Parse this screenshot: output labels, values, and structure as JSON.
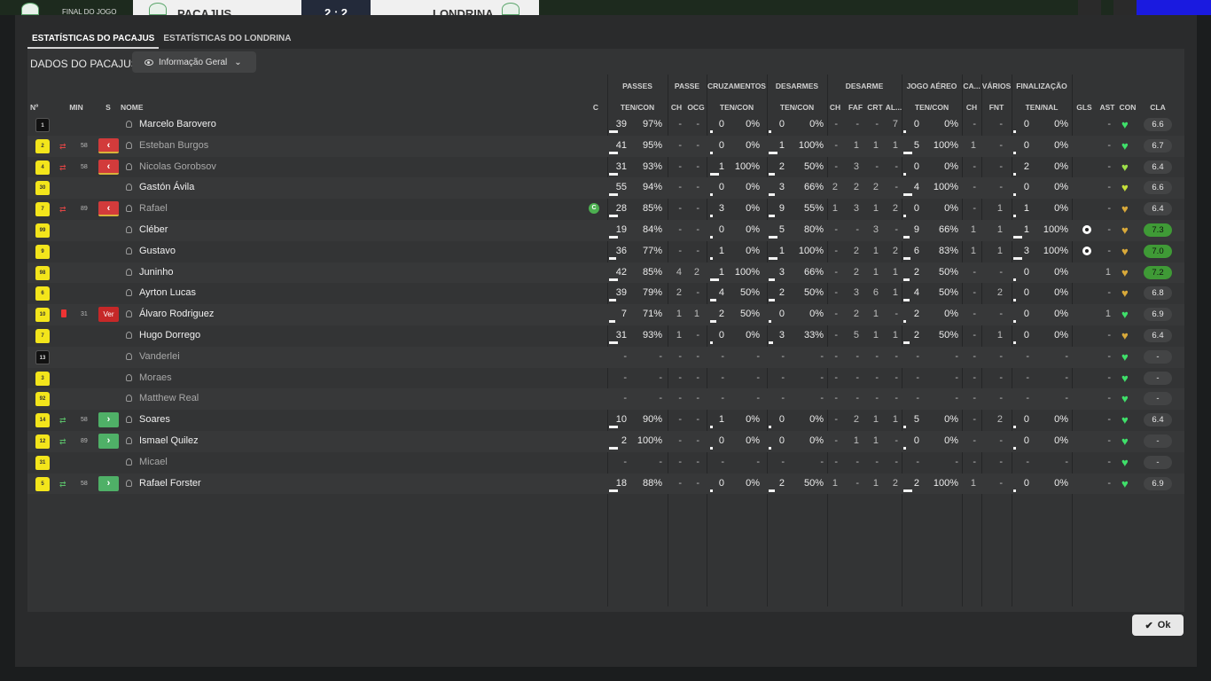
{
  "scoreboard": {
    "status": "FINAL DO JOGO",
    "home": "PACAJUS",
    "score": "2 : 2",
    "away": "LONDRINA"
  },
  "tabs": [
    {
      "label": "ESTATÍSTICAS DO PACAJUS",
      "active": true
    },
    {
      "label": "ESTATÍSTICAS DO LONDRINA",
      "active": false
    }
  ],
  "panel": {
    "title": "DADOS DO PACAJUS",
    "view_button": "Informação Geral"
  },
  "headers": {
    "groups": [
      "PASSES",
      "PASSE",
      "CRUZAMENTOS",
      "DESARMES",
      "DESARME",
      "JOGO AÉREO",
      "CA...",
      "VÁRIOS",
      "FINALIZAÇÃO"
    ],
    "columns": {
      "no": "Nº",
      "min": "MIN",
      "s": "S",
      "nome": "NOME",
      "c": "C",
      "passes": "TEN/CON",
      "ch1": "CH",
      "ocg": "OCG",
      "cruz": "TEN/CON",
      "desarmes": "TEN/CON",
      "ch2": "CH",
      "faf": "FAF",
      "crt": "CRT",
      "al": "AL...",
      "aereo": "TEN/CON",
      "ch3": "CH",
      "fnt": "FNT",
      "final": "TEN/NAL",
      "gls": "GLS",
      "ast": "AST",
      "con": "CON",
      "cla": "CLA"
    }
  },
  "players": [
    {
      "no": "1",
      "shirt": "b",
      "sub": "",
      "min": "",
      "btn": "",
      "name": "Marcelo Barovero",
      "dim": false,
      "captain": false,
      "passes": [
        "39",
        "97%"
      ],
      "passes_fill": 0.4,
      "ch1": "-",
      "ocg": "-",
      "cruz": [
        "0",
        "0%"
      ],
      "cruz_fill": 0,
      "des": [
        "0",
        "0%"
      ],
      "des_fill": 0,
      "dch": "-",
      "faf": "-",
      "crt": "-",
      "al": "7",
      "aer": [
        "0",
        "0%"
      ],
      "aer_fill": 0,
      "ach": "-",
      "fnt": "-",
      "fin": [
        "0",
        "0%"
      ],
      "fin_fill": 0,
      "gls": false,
      "ast": "-",
      "con": "#3fe06a",
      "cla": "6.6",
      "cla_hi": false
    },
    {
      "no": "2",
      "shirt": "y",
      "sub": "out",
      "min": "58",
      "btn": "out",
      "name": "Esteban Burgos",
      "dim": true,
      "captain": false,
      "passes": [
        "41",
        "95%"
      ],
      "passes_fill": 0.4,
      "ch1": "-",
      "ocg": "-",
      "cruz": [
        "0",
        "0%"
      ],
      "cruz_fill": 0,
      "des": [
        "1",
        "100%"
      ],
      "des_fill": 0.4,
      "dch": "-",
      "faf": "1",
      "crt": "1",
      "al": "1",
      "aer": [
        "5",
        "100%"
      ],
      "aer_fill": 0.4,
      "ach": "1",
      "fnt": "-",
      "fin": [
        "0",
        "0%"
      ],
      "fin_fill": 0,
      "gls": false,
      "ast": "-",
      "con": "#3fe06a",
      "cla": "6.7",
      "cla_hi": false
    },
    {
      "no": "4",
      "shirt": "y",
      "sub": "out",
      "min": "58",
      "btn": "out",
      "name": "Nicolas Gorobsov",
      "dim": true,
      "captain": false,
      "passes": [
        "31",
        "93%"
      ],
      "passes_fill": 0.4,
      "ch1": "-",
      "ocg": "-",
      "cruz": [
        "1",
        "100%"
      ],
      "cruz_fill": 0.4,
      "des": [
        "2",
        "50%"
      ],
      "des_fill": 0.3,
      "dch": "-",
      "faf": "3",
      "crt": "-",
      "al": "-",
      "aer": [
        "0",
        "0%"
      ],
      "aer_fill": 0,
      "ach": "-",
      "fnt": "-",
      "fin": [
        "2",
        "0%"
      ],
      "fin_fill": 0,
      "gls": false,
      "ast": "-",
      "con": "#9ee04a",
      "cla": "6.4",
      "cla_hi": false
    },
    {
      "no": "30",
      "shirt": "y",
      "sub": "",
      "min": "",
      "btn": "",
      "name": "Gastón Ávila",
      "dim": false,
      "captain": false,
      "passes": [
        "55",
        "94%"
      ],
      "passes_fill": 0.4,
      "ch1": "-",
      "ocg": "-",
      "cruz": [
        "0",
        "0%"
      ],
      "cruz_fill": 0,
      "des": [
        "3",
        "66%"
      ],
      "des_fill": 0.3,
      "dch": "2",
      "faf": "2",
      "crt": "2",
      "al": "-",
      "aer": [
        "4",
        "100%"
      ],
      "aer_fill": 0.4,
      "ach": "-",
      "fnt": "-",
      "fin": [
        "0",
        "0%"
      ],
      "fin_fill": 0,
      "gls": false,
      "ast": "-",
      "con": "#c6e03a",
      "cla": "6.6",
      "cla_hi": false
    },
    {
      "no": "7",
      "shirt": "y",
      "sub": "out",
      "min": "89",
      "btn": "out",
      "name": "Rafael",
      "dim": true,
      "captain": true,
      "passes": [
        "28",
        "85%"
      ],
      "passes_fill": 0.4,
      "ch1": "-",
      "ocg": "-",
      "cruz": [
        "3",
        "0%"
      ],
      "cruz_fill": 0,
      "des": [
        "9",
        "55%"
      ],
      "des_fill": 0.3,
      "dch": "1",
      "faf": "3",
      "crt": "1",
      "al": "2",
      "aer": [
        "0",
        "0%"
      ],
      "aer_fill": 0,
      "ach": "-",
      "fnt": "1",
      "fin": [
        "1",
        "0%"
      ],
      "fin_fill": 0,
      "gls": false,
      "ast": "-",
      "con": "#d9a93a",
      "cla": "6.4",
      "cla_hi": false
    },
    {
      "no": "99",
      "shirt": "y",
      "sub": "",
      "min": "",
      "btn": "",
      "name": "Cléber",
      "dim": false,
      "captain": false,
      "passes": [
        "19",
        "84%"
      ],
      "passes_fill": 0.4,
      "ch1": "-",
      "ocg": "-",
      "cruz": [
        "0",
        "0%"
      ],
      "cruz_fill": 0,
      "des": [
        "5",
        "80%"
      ],
      "des_fill": 0.4,
      "dch": "-",
      "faf": "-",
      "crt": "3",
      "al": "-",
      "aer": [
        "9",
        "66%"
      ],
      "aer_fill": 0.3,
      "ach": "1",
      "fnt": "1",
      "fin": [
        "1",
        "100%"
      ],
      "fin_fill": 0.4,
      "gls": true,
      "ast": "-",
      "con": "#d9a93a",
      "cla": "7.3",
      "cla_hi": true
    },
    {
      "no": "9",
      "shirt": "y",
      "sub": "",
      "min": "",
      "btn": "",
      "name": "Gustavo",
      "dim": false,
      "captain": false,
      "passes": [
        "36",
        "77%"
      ],
      "passes_fill": 0.35,
      "ch1": "-",
      "ocg": "-",
      "cruz": [
        "1",
        "0%"
      ],
      "cruz_fill": 0,
      "des": [
        "1",
        "100%"
      ],
      "des_fill": 0.4,
      "dch": "-",
      "faf": "2",
      "crt": "1",
      "al": "2",
      "aer": [
        "6",
        "83%"
      ],
      "aer_fill": 0.35,
      "ach": "1",
      "fnt": "1",
      "fin": [
        "3",
        "100%"
      ],
      "fin_fill": 0.4,
      "gls": true,
      "ast": "-",
      "con": "#d9a93a",
      "cla": "7.0",
      "cla_hi": true
    },
    {
      "no": "98",
      "shirt": "y",
      "sub": "",
      "min": "",
      "btn": "",
      "name": "Juninho",
      "dim": false,
      "captain": false,
      "passes": [
        "42",
        "85%"
      ],
      "passes_fill": 0.4,
      "ch1": "4",
      "ocg": "2",
      "cruz": [
        "1",
        "100%"
      ],
      "cruz_fill": 0.4,
      "des": [
        "3",
        "66%"
      ],
      "des_fill": 0.3,
      "dch": "-",
      "faf": "2",
      "crt": "1",
      "al": "1",
      "aer": [
        "2",
        "50%"
      ],
      "aer_fill": 0.3,
      "ach": "-",
      "fnt": "-",
      "fin": [
        "0",
        "0%"
      ],
      "fin_fill": 0,
      "gls": false,
      "ast": "1",
      "con": "#d9a93a",
      "cla": "7.2",
      "cla_hi": true
    },
    {
      "no": "6",
      "shirt": "y",
      "sub": "",
      "min": "",
      "btn": "",
      "name": "Ayrton Lucas",
      "dim": false,
      "captain": false,
      "passes": [
        "39",
        "79%"
      ],
      "passes_fill": 0.35,
      "ch1": "2",
      "ocg": "-",
      "cruz": [
        "4",
        "50%"
      ],
      "cruz_fill": 0.3,
      "des": [
        "2",
        "50%"
      ],
      "des_fill": 0.3,
      "dch": "-",
      "faf": "3",
      "crt": "6",
      "al": "1",
      "aer": [
        "4",
        "50%"
      ],
      "aer_fill": 0.3,
      "ach": "-",
      "fnt": "2",
      "fin": [
        "0",
        "0%"
      ],
      "fin_fill": 0,
      "gls": false,
      "ast": "-",
      "con": "#d9a93a",
      "cla": "6.8",
      "cla_hi": false
    },
    {
      "no": "10",
      "shirt": "y",
      "sub": "red",
      "min": "31",
      "btn": "ver",
      "name": "Álvaro Rodriguez",
      "dim": false,
      "captain": false,
      "passes": [
        "7",
        "71%"
      ],
      "passes_fill": 0.3,
      "ch1": "1",
      "ocg": "1",
      "cruz": [
        "2",
        "50%"
      ],
      "cruz_fill": 0.3,
      "des": [
        "0",
        "0%"
      ],
      "des_fill": 0,
      "dch": "-",
      "faf": "2",
      "crt": "1",
      "al": "-",
      "aer": [
        "2",
        "0%"
      ],
      "aer_fill": 0,
      "ach": "-",
      "fnt": "-",
      "fin": [
        "0",
        "0%"
      ],
      "fin_fill": 0,
      "gls": false,
      "ast": "1",
      "con": "#3fe06a",
      "cla": "6.9",
      "cla_hi": false
    },
    {
      "no": "7",
      "shirt": "y",
      "sub": "",
      "min": "",
      "btn": "",
      "name": "Hugo Dorrego",
      "dim": false,
      "captain": false,
      "passes": [
        "31",
        "93%"
      ],
      "passes_fill": 0.4,
      "ch1": "1",
      "ocg": "-",
      "cruz": [
        "0",
        "0%"
      ],
      "cruz_fill": 0,
      "des": [
        "3",
        "33%"
      ],
      "des_fill": 0.2,
      "dch": "-",
      "faf": "5",
      "crt": "1",
      "al": "1",
      "aer": [
        "2",
        "50%"
      ],
      "aer_fill": 0.3,
      "ach": "-",
      "fnt": "1",
      "fin": [
        "0",
        "0%"
      ],
      "fin_fill": 0,
      "gls": false,
      "ast": "-",
      "con": "#d9a93a",
      "cla": "6.4",
      "cla_hi": false
    },
    {
      "no": "13",
      "shirt": "b",
      "sub": "",
      "min": "",
      "btn": "",
      "name": "Vanderlei",
      "dim": true,
      "captain": false,
      "passes": [
        "-",
        "-"
      ],
      "passes_fill": 0,
      "ch1": "-",
      "ocg": "-",
      "cruz": [
        "-",
        "-"
      ],
      "cruz_fill": 0,
      "des": [
        "-",
        "-"
      ],
      "des_fill": 0,
      "dch": "-",
      "faf": "-",
      "crt": "-",
      "al": "-",
      "aer": [
        "-",
        "-"
      ],
      "aer_fill": 0,
      "ach": "-",
      "fnt": "-",
      "fin": [
        "-",
        "-"
      ],
      "fin_fill": 0,
      "gls": false,
      "ast": "-",
      "con": "#3fe06a",
      "cla": "-",
      "cla_hi": false
    },
    {
      "no": "3",
      "shirt": "y",
      "sub": "",
      "min": "",
      "btn": "",
      "name": "Moraes",
      "dim": true,
      "captain": false,
      "passes": [
        "-",
        "-"
      ],
      "passes_fill": 0,
      "ch1": "-",
      "ocg": "-",
      "cruz": [
        "-",
        "-"
      ],
      "cruz_fill": 0,
      "des": [
        "-",
        "-"
      ],
      "des_fill": 0,
      "dch": "-",
      "faf": "-",
      "crt": "-",
      "al": "-",
      "aer": [
        "-",
        "-"
      ],
      "aer_fill": 0,
      "ach": "-",
      "fnt": "-",
      "fin": [
        "-",
        "-"
      ],
      "fin_fill": 0,
      "gls": false,
      "ast": "-",
      "con": "#3fe06a",
      "cla": "-",
      "cla_hi": false
    },
    {
      "no": "92",
      "shirt": "y",
      "sub": "",
      "min": "",
      "btn": "",
      "name": "Matthew Real",
      "dim": true,
      "captain": false,
      "passes": [
        "-",
        "-"
      ],
      "passes_fill": 0,
      "ch1": "-",
      "ocg": "-",
      "cruz": [
        "-",
        "-"
      ],
      "cruz_fill": 0,
      "des": [
        "-",
        "-"
      ],
      "des_fill": 0,
      "dch": "-",
      "faf": "-",
      "crt": "-",
      "al": "-",
      "aer": [
        "-",
        "-"
      ],
      "aer_fill": 0,
      "ach": "-",
      "fnt": "-",
      "fin": [
        "-",
        "-"
      ],
      "fin_fill": 0,
      "gls": false,
      "ast": "-",
      "con": "#3fe06a",
      "cla": "-",
      "cla_hi": false
    },
    {
      "no": "14",
      "shirt": "y",
      "sub": "in",
      "min": "58",
      "btn": "in",
      "name": "Soares",
      "dim": false,
      "captain": false,
      "passes": [
        "10",
        "90%"
      ],
      "passes_fill": 0.4,
      "ch1": "-",
      "ocg": "-",
      "cruz": [
        "1",
        "0%"
      ],
      "cruz_fill": 0,
      "des": [
        "0",
        "0%"
      ],
      "des_fill": 0,
      "dch": "-",
      "faf": "2",
      "crt": "1",
      "al": "1",
      "aer": [
        "5",
        "0%"
      ],
      "aer_fill": 0,
      "ach": "-",
      "fnt": "2",
      "fin": [
        "0",
        "0%"
      ],
      "fin_fill": 0,
      "gls": false,
      "ast": "-",
      "con": "#3fe06a",
      "cla": "6.4",
      "cla_hi": false
    },
    {
      "no": "12",
      "shirt": "y",
      "sub": "in",
      "min": "89",
      "btn": "in",
      "name": "Ismael Quilez",
      "dim": false,
      "captain": false,
      "passes": [
        "2",
        "100%"
      ],
      "passes_fill": 0.4,
      "ch1": "-",
      "ocg": "-",
      "cruz": [
        "0",
        "0%"
      ],
      "cruz_fill": 0,
      "des": [
        "0",
        "0%"
      ],
      "des_fill": 0,
      "dch": "-",
      "faf": "1",
      "crt": "1",
      "al": "-",
      "aer": [
        "0",
        "0%"
      ],
      "aer_fill": 0,
      "ach": "-",
      "fnt": "-",
      "fin": [
        "0",
        "0%"
      ],
      "fin_fill": 0,
      "gls": false,
      "ast": "-",
      "con": "#3fe06a",
      "cla": "-",
      "cla_hi": false
    },
    {
      "no": "31",
      "shirt": "y",
      "sub": "",
      "min": "",
      "btn": "",
      "name": "Micael",
      "dim": true,
      "captain": false,
      "passes": [
        "-",
        "-"
      ],
      "passes_fill": 0,
      "ch1": "-",
      "ocg": "-",
      "cruz": [
        "-",
        "-"
      ],
      "cruz_fill": 0,
      "des": [
        "-",
        "-"
      ],
      "des_fill": 0,
      "dch": "-",
      "faf": "-",
      "crt": "-",
      "al": "-",
      "aer": [
        "-",
        "-"
      ],
      "aer_fill": 0,
      "ach": "-",
      "fnt": "-",
      "fin": [
        "-",
        "-"
      ],
      "fin_fill": 0,
      "gls": false,
      "ast": "-",
      "con": "#3fe06a",
      "cla": "-",
      "cla_hi": false
    },
    {
      "no": "5",
      "shirt": "y",
      "sub": "in",
      "min": "58",
      "btn": "in",
      "name": "Rafael Forster",
      "dim": false,
      "captain": false,
      "passes": [
        "18",
        "88%"
      ],
      "passes_fill": 0.4,
      "ch1": "-",
      "ocg": "-",
      "cruz": [
        "0",
        "0%"
      ],
      "cruz_fill": 0,
      "des": [
        "2",
        "50%"
      ],
      "des_fill": 0.3,
      "dch": "1",
      "faf": "-",
      "crt": "1",
      "al": "2",
      "aer": [
        "2",
        "100%"
      ],
      "aer_fill": 0.4,
      "ach": "1",
      "fnt": "-",
      "fin": [
        "0",
        "0%"
      ],
      "fin_fill": 0,
      "gls": false,
      "ast": "-",
      "con": "#3fe06a",
      "cla": "6.9",
      "cla_hi": false
    }
  ],
  "ok_button": "Ok",
  "colors": {
    "accent_green": "#3f9a36",
    "sub_out": "#d23b3b",
    "sub_in": "#4fb067",
    "shirt": "#f3e51b"
  }
}
